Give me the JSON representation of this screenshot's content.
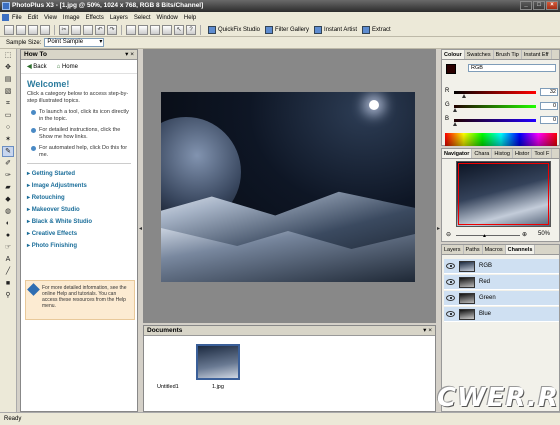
{
  "window": {
    "title": "PhotoPlus X3 - [1.jpg @ 50%, 1024 x 768, RGB 8 Bits/Channel]"
  },
  "menu": [
    "File",
    "Edit",
    "View",
    "Image",
    "Effects",
    "Layers",
    "Select",
    "Window",
    "Help"
  ],
  "toolbar": {
    "quickfix": "QuickFix Studio",
    "filter_gallery": "Filter Gallery",
    "instant_artist": "Instant Artist",
    "extract": "Extract"
  },
  "context_toolbar": {
    "sample_size_label": "Sample Size:",
    "sample_size_value": "Point Sample"
  },
  "howto": {
    "title": "How To",
    "back": "Back",
    "home": "Home",
    "welcome": "Welcome!",
    "intro": "Click a category below to access step-by-step illustrated topics.",
    "bullets": [
      "To launch a tool, click its icon directly in the topic.",
      "For detailed instructions, click the Show me how links.",
      "For automated help, click Do this for me."
    ],
    "categories": [
      "Getting Started",
      "Image Adjustments",
      "Retouching",
      "Makeover Studio",
      "Black & White Studio",
      "Creative Effects",
      "Photo Finishing"
    ],
    "tip": "For more detailed information, see the online Help and tutorials. You can access these resources from the Help menu."
  },
  "documents": {
    "title": "Documents",
    "items": [
      "Untitled1",
      "1.jpg"
    ]
  },
  "colour": {
    "tabs": [
      "Colour",
      "Swatches",
      "Brush Tip",
      "Instant Eff"
    ],
    "mode": "RGB",
    "r": "32",
    "g": "0",
    "b": "0"
  },
  "navigator": {
    "tabs": [
      "Navigator",
      "Chara",
      "Histog",
      "Histor",
      "Tool F"
    ],
    "zoom": "50%"
  },
  "layers": {
    "tabs": [
      "Layers",
      "Paths",
      "Macros",
      "Channels"
    ],
    "channels": [
      "RGB",
      "Red",
      "Green",
      "Blue"
    ]
  },
  "status": "Ready",
  "watermark": "CWER.RU"
}
